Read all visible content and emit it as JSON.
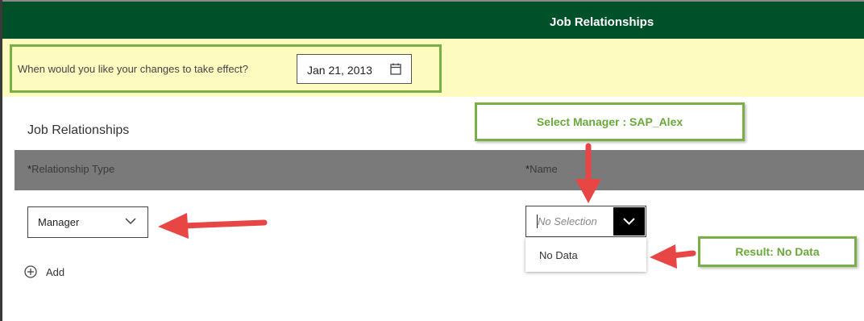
{
  "header": {
    "title": "Job Relationships"
  },
  "effective_date": {
    "question": "When would you like your changes to take effect?",
    "value": "Jan 21, 2013",
    "icon": "calendar-icon"
  },
  "section": {
    "title": "Job Relationships"
  },
  "table": {
    "columns": [
      {
        "required_mark": "*",
        "label": "Relationship Type"
      },
      {
        "required_mark": "*",
        "label": "Name"
      }
    ]
  },
  "row": {
    "relationship_type": "Manager",
    "name_placeholder": "No Selection"
  },
  "dropdown": {
    "items": [
      "No Data"
    ]
  },
  "add": {
    "label": "Add"
  },
  "annotations": {
    "select_note": "Select Manager : SAP_Alex",
    "result_note": "Result: No Data",
    "callout_color": "#78b045",
    "arrow_color": "#e84545"
  },
  "colors": {
    "header_bg": "#00502a",
    "effective_band": "#fdfbbf",
    "grid_header": "#7a7a7a"
  }
}
